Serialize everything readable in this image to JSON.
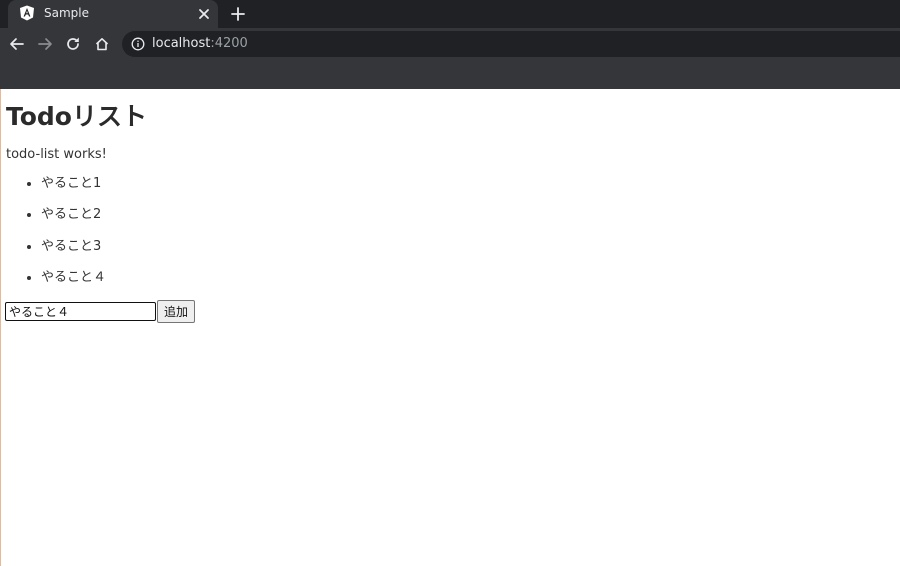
{
  "browser": {
    "tab": {
      "title": "Sample",
      "favicon": "angular-icon"
    },
    "address_bar": {
      "host": "localhost",
      "port": ":4200"
    },
    "colors": {
      "tabstrip": "#202124",
      "toolbar": "#35363a",
      "omnibox": "#202124"
    }
  },
  "page": {
    "heading": "Todoリスト",
    "works_text": "todo-list works!",
    "todos": [
      "やること1",
      "やること2",
      "やること3",
      "やること４"
    ],
    "input": {
      "value": "やること４"
    },
    "add_button_label": "追加"
  }
}
